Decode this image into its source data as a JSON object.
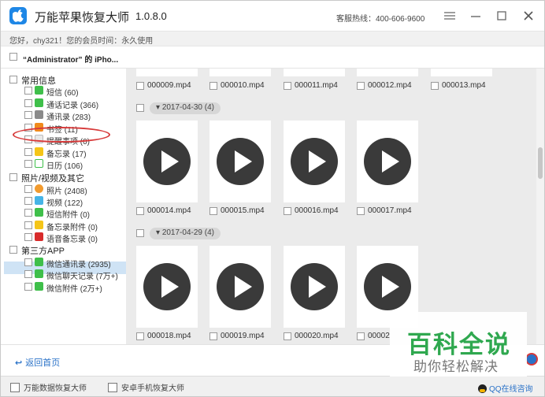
{
  "app": {
    "title": "万能苹果恢复大师",
    "version": "1.0.8.0",
    "hotline": "客服热线：400-606-9600",
    "greeting": "您好，chy321！您的会员时间：永久使用",
    "device": "“Administrator” 的 iPho..."
  },
  "sidebar": {
    "groups": [
      {
        "label": "常用信息",
        "items": [
          {
            "label": "短信 (60)",
            "icon": "message-icon",
            "color": "#3fbf4a"
          },
          {
            "label": "通话记录 (366)",
            "icon": "phone-icon",
            "color": "#3fbf4a"
          },
          {
            "label": "通讯录 (283)",
            "icon": "contacts-icon",
            "color": "#8a8a8a"
          },
          {
            "label": "书签 (11)",
            "icon": "bookmark-icon",
            "color": "#f08a1c"
          },
          {
            "label": "提醒事项 (0)",
            "icon": "reminder-icon",
            "color": "#e8e8e8"
          },
          {
            "label": "备忘录 (17)",
            "icon": "notes-icon",
            "color": "#f5c518"
          },
          {
            "label": "日历 (106)",
            "icon": "calendar-icon",
            "color": "#ffffff"
          }
        ]
      },
      {
        "label": "照片/视频及其它",
        "items": [
          {
            "label": "照片 (2408)",
            "icon": "photos-icon",
            "color": "#f29b2e"
          },
          {
            "label": "视频 (122)",
            "icon": "video-icon",
            "color": "#46b4e6"
          },
          {
            "label": "短信附件 (0)",
            "icon": "attachment-icon",
            "color": "#3fbf4a"
          },
          {
            "label": "备忘录附件 (0)",
            "icon": "notes-attachment-icon",
            "color": "#f5c518"
          },
          {
            "label": "语音备忘录 (0)",
            "icon": "voice-memo-icon",
            "color": "#d82b2b"
          }
        ]
      },
      {
        "label": "第三方APP",
        "items": [
          {
            "label": "微信通讯录 (2935)",
            "icon": "wechat-icon",
            "color": "#3fbf4a"
          },
          {
            "label": "微信聊天记录 (7万+)",
            "icon": "wechat-icon",
            "color": "#3fbf4a"
          },
          {
            "label": "微信附件 (2万+)",
            "icon": "wechat-icon",
            "color": "#3fbf4a"
          }
        ]
      }
    ]
  },
  "content": {
    "top_row": [
      "000009.mp4",
      "000010.mp4",
      "000011.mp4",
      "000012.mp4",
      "000013.mp4"
    ],
    "sections": [
      {
        "date": "2017-04-30 (4)",
        "files": [
          "000014.mp4",
          "000015.mp4",
          "000016.mp4",
          "000017.mp4"
        ]
      },
      {
        "date": "2017-04-29 (4)",
        "files": [
          "000018.mp4",
          "000019.mp4",
          "000020.mp4",
          "00002"
        ]
      }
    ]
  },
  "footer": {
    "back_label": "返回首页"
  },
  "statusbar": {
    "left1": "万能数据恢复大师",
    "left2": "安卓手机恢复大师",
    "qq": "QQ在线咨询"
  },
  "watermark": {
    "line1": "百科全说",
    "line2": "助你轻松解决"
  }
}
